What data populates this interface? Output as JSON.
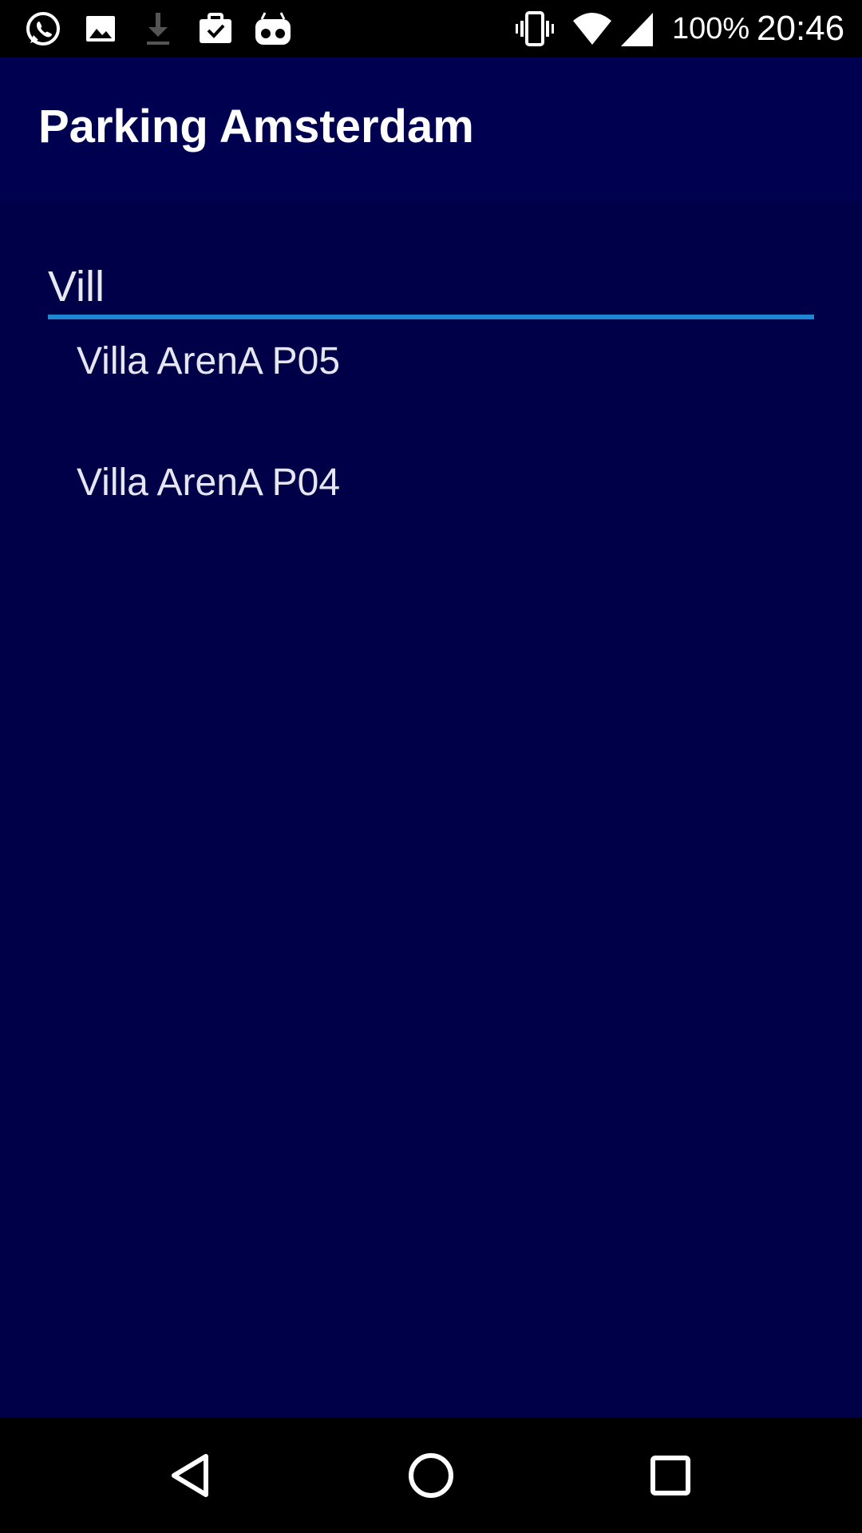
{
  "status_bar": {
    "left_icons": [
      "whatsapp-icon",
      "image-icon",
      "download-icon",
      "clipboard-check-icon",
      "voicemail-robot-icon"
    ],
    "right_icons": [
      "vibrate-icon",
      "wifi-icon",
      "signal-icon"
    ],
    "battery": "100%",
    "time": "20:46"
  },
  "app_bar": {
    "title": "Parking Amsterdam"
  },
  "search": {
    "value": "Vill"
  },
  "suggestions": [
    {
      "label": "Villa ArenA P05"
    },
    {
      "label": "Villa ArenA P04"
    }
  ],
  "colors": {
    "background": "#000048",
    "accent": "#1f86d2"
  },
  "nav_bar": {
    "buttons": [
      "back-icon",
      "home-icon",
      "recents-icon"
    ]
  }
}
